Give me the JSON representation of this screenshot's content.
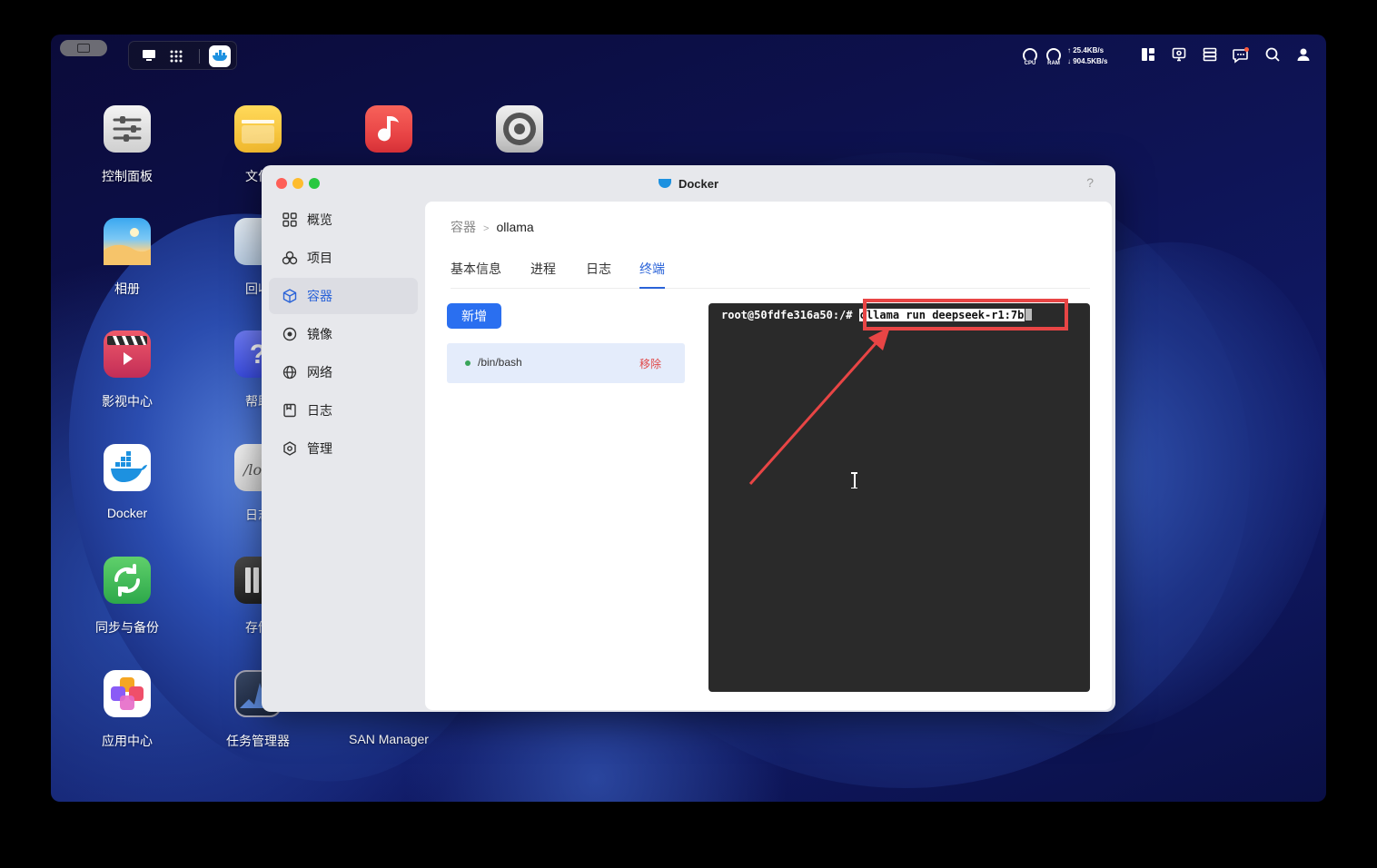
{
  "topbar": {
    "cpu_label": "CPU",
    "ram_label": "RAM",
    "upload": "↑ 25.4KB/s",
    "download": "↓ 904.5KB/s"
  },
  "desktop": {
    "icons": [
      {
        "label": "控制面板"
      },
      {
        "label": "文件"
      },
      {
        "label": "相册"
      },
      {
        "label": "回收"
      },
      {
        "label": "影视中心"
      },
      {
        "label": "帮助"
      },
      {
        "label": "Docker"
      },
      {
        "label": "日志"
      },
      {
        "label": "同步与备份"
      },
      {
        "label": "存储"
      },
      {
        "label": "应用中心"
      },
      {
        "label": "任务管理器"
      },
      {
        "label": "SAN Manager"
      }
    ]
  },
  "window": {
    "title": "Docker",
    "help": "?",
    "sidebar": [
      {
        "label": "概览",
        "icon": "grid-icon"
      },
      {
        "label": "项目",
        "icon": "cluster-icon"
      },
      {
        "label": "容器",
        "icon": "cube-icon",
        "active": true
      },
      {
        "label": "镜像",
        "icon": "disc-icon"
      },
      {
        "label": "网络",
        "icon": "globe-icon"
      },
      {
        "label": "日志",
        "icon": "log-icon"
      },
      {
        "label": "管理",
        "icon": "settings-icon"
      }
    ],
    "breadcrumb": {
      "parent": "容器",
      "separator": ">",
      "current": "ollama"
    },
    "tabs": [
      {
        "label": "基本信息"
      },
      {
        "label": "进程"
      },
      {
        "label": "日志"
      },
      {
        "label": "终端",
        "active": true
      }
    ],
    "new_button": "新增",
    "session": {
      "name": "/bin/bash",
      "remove": "移除"
    },
    "terminal": {
      "prompt": "root@50fdfe316a50:/#",
      "command": "ollama run deepseek-r1:7b"
    }
  },
  "colors": {
    "accent": "#2a6ff0",
    "highlight_box": "#e84545",
    "terminal_bg": "#2a2a2a"
  }
}
